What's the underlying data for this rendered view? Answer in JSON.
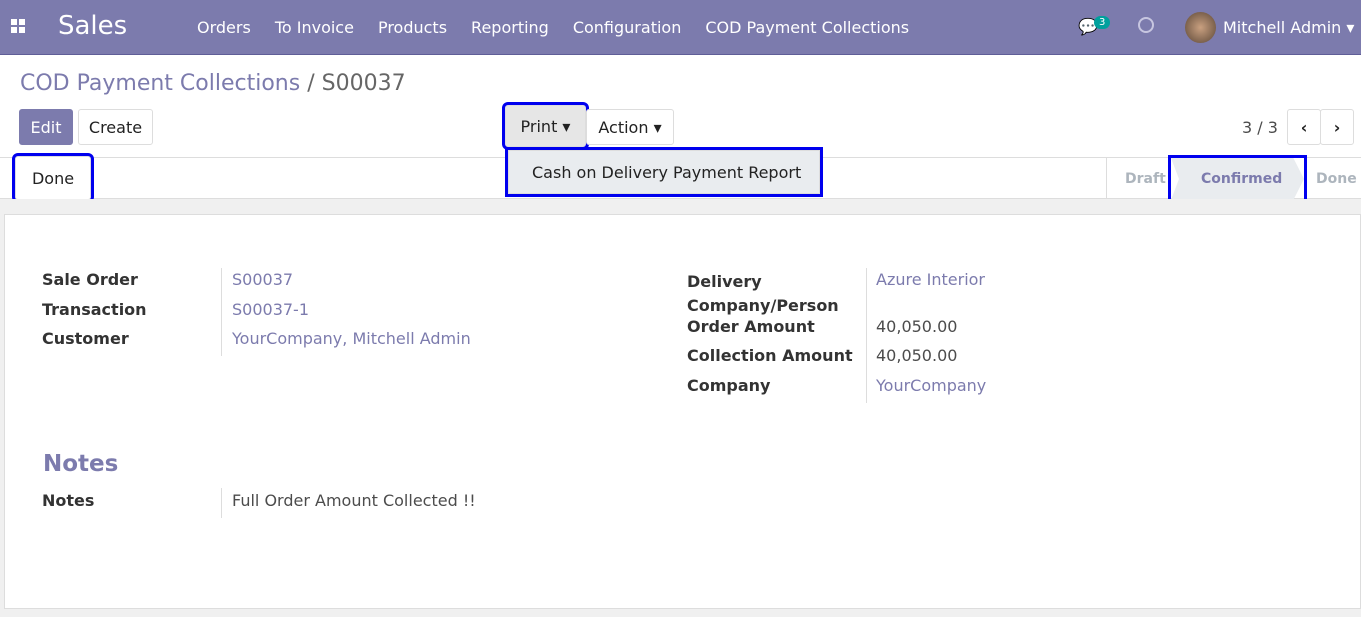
{
  "nav": {
    "app": "Sales",
    "menu": [
      "Orders",
      "To Invoice",
      "Products",
      "Reporting",
      "Configuration",
      "COD Payment Collections"
    ],
    "messages_count": "3",
    "user": "Mitchell Admin"
  },
  "breadcrumb": {
    "parent": "COD Payment Collections",
    "sep": " / ",
    "current": "S00037"
  },
  "toolbar": {
    "edit": "Edit",
    "create": "Create",
    "print": "Print",
    "action": "Action",
    "pager": "3 / 3"
  },
  "print_menu": [
    "Cash on Delivery Payment Report"
  ],
  "statusbar": {
    "done_button": "Done",
    "stages": [
      "Draft",
      "Confirmed",
      "Done"
    ],
    "active": "Confirmed"
  },
  "form": {
    "left": [
      {
        "label": "Sale Order",
        "value": "S00037"
      },
      {
        "label": "Transaction",
        "value": "S00037-1"
      },
      {
        "label": "Customer",
        "value": "YourCompany, Mitchell Admin"
      }
    ],
    "right": [
      {
        "label": "Delivery Company/Person",
        "value": "Azure Interior"
      },
      {
        "label": "Order Amount",
        "value": "40,050.00"
      },
      {
        "label": "Collection Amount",
        "value": "40,050.00"
      },
      {
        "label": "Company",
        "value": "YourCompany"
      }
    ],
    "notes_heading": "Notes",
    "notes_label": "Notes",
    "notes_value": "Full Order Amount Collected !!"
  }
}
